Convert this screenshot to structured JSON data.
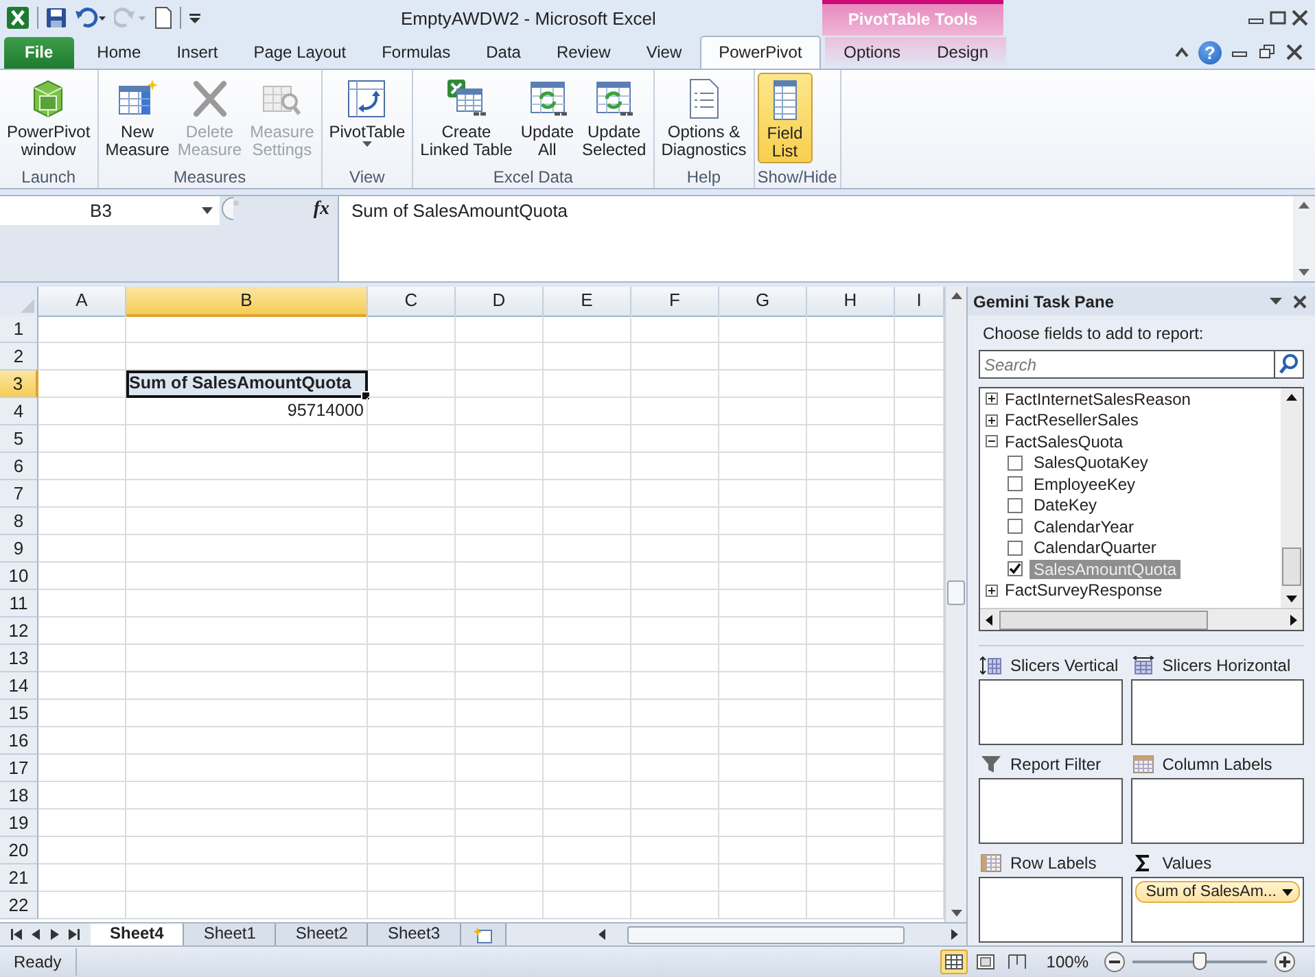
{
  "title_bar": {
    "title": "EmptyAWDW2  -  Microsoft Excel",
    "contextual_title": "PivotTable Tools"
  },
  "ribbon_tabs": [
    {
      "label": "File",
      "kind": "file",
      "selected": false
    },
    {
      "label": "Home",
      "kind": "normal",
      "selected": false
    },
    {
      "label": "Insert",
      "kind": "normal",
      "selected": false
    },
    {
      "label": "Page Layout",
      "kind": "normal",
      "selected": false
    },
    {
      "label": "Formulas",
      "kind": "normal",
      "selected": false
    },
    {
      "label": "Data",
      "kind": "normal",
      "selected": false
    },
    {
      "label": "Review",
      "kind": "normal",
      "selected": false
    },
    {
      "label": "View",
      "kind": "normal",
      "selected": false
    },
    {
      "label": "PowerPivot",
      "kind": "normal",
      "selected": true
    },
    {
      "label": "Options",
      "kind": "contextual",
      "selected": false
    },
    {
      "label": "Design",
      "kind": "contextual",
      "selected": false
    }
  ],
  "help_label": "?",
  "ribbon_groups": [
    {
      "label": "Launch",
      "buttons": [
        {
          "lines": [
            "PowerPivot",
            "window"
          ],
          "kind": "powerpivot",
          "disabled": false,
          "selected": false
        }
      ]
    },
    {
      "label": "Measures",
      "buttons": [
        {
          "lines": [
            "New",
            "Measure"
          ],
          "kind": "new_measure",
          "disabled": false,
          "selected": false
        },
        {
          "lines": [
            "Delete",
            "Measure"
          ],
          "kind": "delete",
          "disabled": true,
          "selected": false
        },
        {
          "lines": [
            "Measure",
            "Settings"
          ],
          "kind": "settings",
          "disabled": true,
          "selected": false
        }
      ]
    },
    {
      "label": "View",
      "buttons": [
        {
          "lines": [
            "PivotTable"
          ],
          "kind": "pivottable",
          "disabled": false,
          "selected": false,
          "has_menu": true
        }
      ]
    },
    {
      "label": "Excel Data",
      "buttons": [
        {
          "lines": [
            "Create",
            "Linked Table"
          ],
          "kind": "linked_table",
          "disabled": false,
          "selected": false
        },
        {
          "lines": [
            "Update",
            "All"
          ],
          "kind": "update",
          "disabled": false,
          "selected": false
        },
        {
          "lines": [
            "Update",
            "Selected"
          ],
          "kind": "update",
          "disabled": false,
          "selected": false
        }
      ]
    },
    {
      "label": "Help",
      "buttons": [
        {
          "lines": [
            "Options &",
            "Diagnostics"
          ],
          "kind": "document",
          "disabled": false,
          "selected": false
        }
      ]
    },
    {
      "label": "Show/Hide",
      "buttons": [
        {
          "lines": [
            "Field",
            "List"
          ],
          "kind": "field_list",
          "disabled": false,
          "selected": true
        }
      ]
    }
  ],
  "formula_bar": {
    "name_box": "B3",
    "function_label": "fx",
    "formula": "Sum of SalesAmountQuota"
  },
  "sheet": {
    "columns": [
      {
        "label": "A",
        "selected": false
      },
      {
        "label": "B",
        "selected": true
      },
      {
        "label": "C",
        "selected": false
      },
      {
        "label": "D",
        "selected": false
      },
      {
        "label": "E",
        "selected": false
      },
      {
        "label": "F",
        "selected": false
      },
      {
        "label": "G",
        "selected": false
      },
      {
        "label": "H",
        "selected": false
      },
      {
        "label": "I",
        "selected": false
      }
    ],
    "rows": [
      {
        "label": "1",
        "selected": false
      },
      {
        "label": "2",
        "selected": false
      },
      {
        "label": "3",
        "selected": true,
        "cells": [
          {
            "selected": false
          },
          {
            "text": "Sum of SalesAmountQuota",
            "kind": "pivot_header",
            "selected": true
          }
        ]
      },
      {
        "label": "4",
        "selected": false,
        "cells": [
          {
            "selected": false
          },
          {
            "text": "95714000",
            "kind": "number",
            "selected": false
          }
        ]
      },
      {
        "label": "5",
        "selected": false
      },
      {
        "label": "6",
        "selected": false
      },
      {
        "label": "7",
        "selected": false
      },
      {
        "label": "8",
        "selected": false
      },
      {
        "label": "9",
        "selected": false
      },
      {
        "label": "10",
        "selected": false
      },
      {
        "label": "11",
        "selected": false
      },
      {
        "label": "12",
        "selected": false
      },
      {
        "label": "13",
        "selected": false
      },
      {
        "label": "14",
        "selected": false
      },
      {
        "label": "15",
        "selected": false
      },
      {
        "label": "16",
        "selected": false
      },
      {
        "label": "17",
        "selected": false
      },
      {
        "label": "18",
        "selected": false
      },
      {
        "label": "19",
        "selected": false
      },
      {
        "label": "20",
        "selected": false
      },
      {
        "label": "21",
        "selected": false
      },
      {
        "label": "22",
        "selected": false
      }
    ]
  },
  "sheet_tabs": [
    {
      "label": "Sheet4",
      "selected": true
    },
    {
      "label": "Sheet1",
      "selected": false
    },
    {
      "label": "Sheet2",
      "selected": false
    },
    {
      "label": "Sheet3",
      "selected": false
    }
  ],
  "status_bar": {
    "status": "Ready",
    "views": [
      {
        "kind": "normal",
        "selected": true
      },
      {
        "kind": "page_layout",
        "selected": false
      },
      {
        "kind": "page_break",
        "selected": false
      }
    ],
    "zoom": "100%",
    "zoom_slider": {
      "level": 0.5
    }
  },
  "task_pane": {
    "title": "Gemini Task Pane",
    "prompt": "Choose fields to add to report:",
    "search": {
      "placeholder": "Search"
    },
    "tables": [
      {
        "label": "FactInternetSalesReason",
        "expanded": false
      },
      {
        "label": "FactResellerSales",
        "expanded": false
      },
      {
        "label": "FactSalesQuota",
        "expanded": true,
        "children": [
          {
            "label": "SalesQuotaKey",
            "checked": false,
            "selected": false
          },
          {
            "label": "EmployeeKey",
            "checked": false,
            "selected": false
          },
          {
            "label": "DateKey",
            "checked": false,
            "selected": false
          },
          {
            "label": "CalendarYear",
            "checked": false,
            "selected": false
          },
          {
            "label": "CalendarQuarter",
            "checked": false,
            "selected": false
          },
          {
            "label": "SalesAmountQuota",
            "checked": true,
            "selected": true
          }
        ]
      },
      {
        "label": "FactSurveyResponse",
        "expanded": false
      }
    ],
    "areas": [
      {
        "label": "Slicers Vertical",
        "kind": "slicers_vertical"
      },
      {
        "label": "Slicers Horizontal",
        "kind": "slicers_horizontal"
      },
      {
        "label": "Report Filter",
        "kind": "filter"
      },
      {
        "label": "Column Labels",
        "kind": "columns"
      },
      {
        "label": "Row Labels",
        "kind": "rows"
      },
      {
        "label": "Values",
        "kind": "values",
        "fields": [
          "Sum of SalesAm..."
        ]
      }
    ]
  }
}
